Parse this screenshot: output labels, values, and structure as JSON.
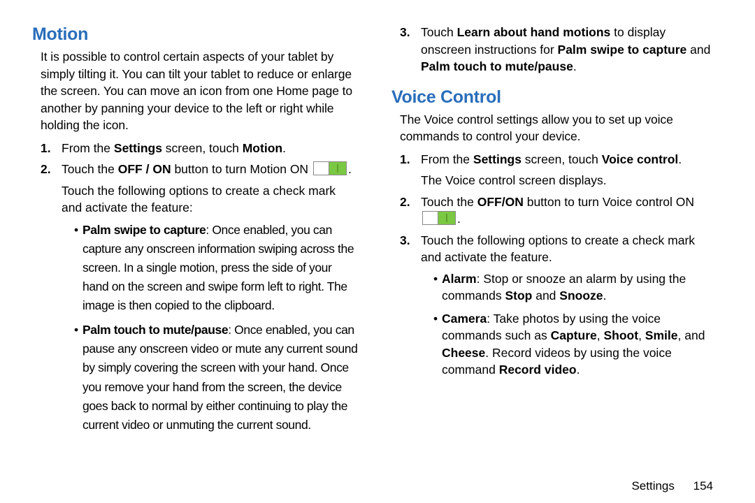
{
  "left": {
    "heading": "Motion",
    "intro": "It is possible to control certain aspects of your tablet by simply tilting it. You can tilt your tablet to reduce or enlarge the screen. You can move an icon from one Home page to another by panning your device to the left or right while holding the icon.",
    "steps": [
      {
        "num": "1.",
        "parts": [
          {
            "t": "From the "
          },
          {
            "t": "Settings",
            "b": true
          },
          {
            "t": " screen, touch "
          },
          {
            "t": "Motion",
            "b": true
          },
          {
            "t": "."
          }
        ]
      },
      {
        "num": "2.",
        "parts": [
          {
            "t": "Touch the "
          },
          {
            "t": "OFF / ON",
            "b": true
          },
          {
            "t": " button to turn Motion ON "
          },
          {
            "toggle": true
          },
          {
            "t": "."
          }
        ],
        "after": "Touch the following options to create a check mark and activate the feature:",
        "bullets": [
          {
            "parts": [
              {
                "t": "Palm swipe to capture",
                "b": true
              },
              {
                "t": ": Once enabled, you can capture any onscreen information swiping across the screen. In a single motion, press the side of your hand on the screen and swipe form left to right. The image is then copied to the clipboard."
              }
            ],
            "condensed": true
          },
          {
            "parts": [
              {
                "t": "Palm touch to mute/pause",
                "b": true
              },
              {
                "t": ": Once enabled, you can pause any onscreen video or mute any current sound by simply covering the screen with your hand. Once you remove your hand from the screen, the device goes back to normal by either continuing to play the current video or unmuting the current sound."
              }
            ],
            "condensed": true
          }
        ]
      }
    ]
  },
  "right_top": {
    "steps": [
      {
        "num": "3.",
        "parts": [
          {
            "t": "Touch "
          },
          {
            "t": "Learn about hand motions",
            "b": true
          },
          {
            "t": " to display onscreen instructions for "
          },
          {
            "t": "Palm swipe to capture",
            "b": true
          },
          {
            "t": " and "
          },
          {
            "t": "Palm touch to mute/pause",
            "b": true
          },
          {
            "t": "."
          }
        ]
      }
    ]
  },
  "right": {
    "heading": "Voice Control",
    "intro": "The Voice control settings allow you to set up voice commands to control your device.",
    "steps": [
      {
        "num": "1.",
        "parts": [
          {
            "t": "From the "
          },
          {
            "t": "Settings",
            "b": true
          },
          {
            "t": " screen, touch "
          },
          {
            "t": "Voice control",
            "b": true
          },
          {
            "t": "."
          }
        ],
        "after": "The Voice control screen displays."
      },
      {
        "num": "2.",
        "parts": [
          {
            "t": "Touch the "
          },
          {
            "t": "OFF/ON",
            "b": true
          },
          {
            "t": " button to turn Voice control ON "
          },
          {
            "toggle": true
          },
          {
            "t": "."
          }
        ]
      },
      {
        "num": "3.",
        "parts": [
          {
            "t": "Touch the following options to create a check mark and activate the feature."
          }
        ],
        "bullets": [
          {
            "parts": [
              {
                "t": "Alarm",
                "b": true
              },
              {
                "t": ": Stop or snooze an alarm by using the commands "
              },
              {
                "t": "Stop",
                "b": true
              },
              {
                "t": " and "
              },
              {
                "t": "Snooze",
                "b": true
              },
              {
                "t": "."
              }
            ]
          },
          {
            "parts": [
              {
                "t": "Camera",
                "b": true
              },
              {
                "t": ": Take photos by using the voice commands such as "
              },
              {
                "t": "Capture",
                "b": true
              },
              {
                "t": ", "
              },
              {
                "t": "Shoot",
                "b": true
              },
              {
                "t": ", "
              },
              {
                "t": "Smile",
                "b": true
              },
              {
                "t": ", and "
              },
              {
                "t": "Cheese",
                "b": true
              },
              {
                "t": ". Record videos by using the voice command "
              },
              {
                "t": "Record video",
                "b": true
              },
              {
                "t": "."
              }
            ]
          }
        ]
      }
    ]
  },
  "footer": {
    "label": "Settings",
    "page": "154"
  }
}
